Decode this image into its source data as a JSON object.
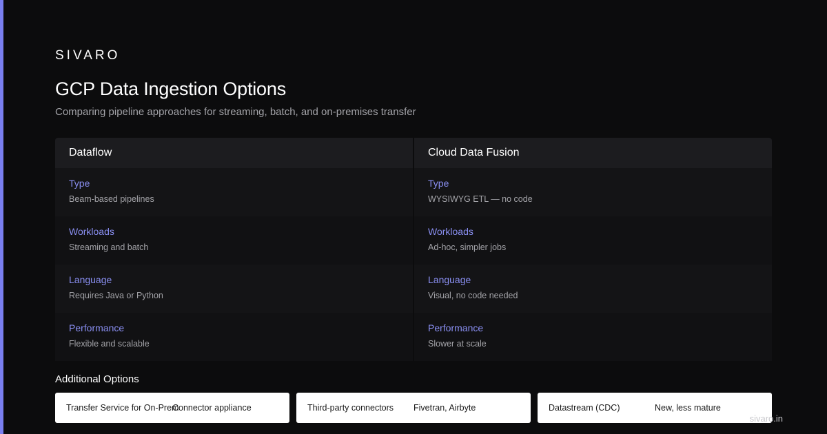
{
  "brand": "SIVARO",
  "title": "GCP Data Ingestion Options",
  "subtitle": "Comparing pipeline approaches for streaming, batch, and on-premises transfer",
  "columns": [
    {
      "name": "Dataflow",
      "rows": [
        {
          "label": "Type",
          "value": "Beam-based pipelines"
        },
        {
          "label": "Workloads",
          "value": "Streaming and batch"
        },
        {
          "label": "Language",
          "value": "Requires Java or Python"
        },
        {
          "label": "Performance",
          "value": "Flexible and scalable"
        }
      ]
    },
    {
      "name": "Cloud Data Fusion",
      "rows": [
        {
          "label": "Type",
          "value": "WYSIWYG ETL — no code"
        },
        {
          "label": "Workloads",
          "value": "Ad-hoc, simpler jobs"
        },
        {
          "label": "Language",
          "value": "Visual, no code needed"
        },
        {
          "label": "Performance",
          "value": "Slower at scale"
        }
      ]
    }
  ],
  "additional": {
    "title": "Additional Options",
    "items": [
      {
        "name": "Transfer Service for On-Prem",
        "desc": "Connector appliance"
      },
      {
        "name": "Third-party connectors",
        "desc": "Fivetran, Airbyte"
      },
      {
        "name": "Datastream (CDC)",
        "desc": "New, less mature"
      }
    ]
  },
  "footer": "sivaro.in",
  "colors": {
    "background": "#0c0c0d",
    "accent": "#7a7ff0",
    "label": "#8a8ff2",
    "header_bg": "#1c1c1f"
  }
}
